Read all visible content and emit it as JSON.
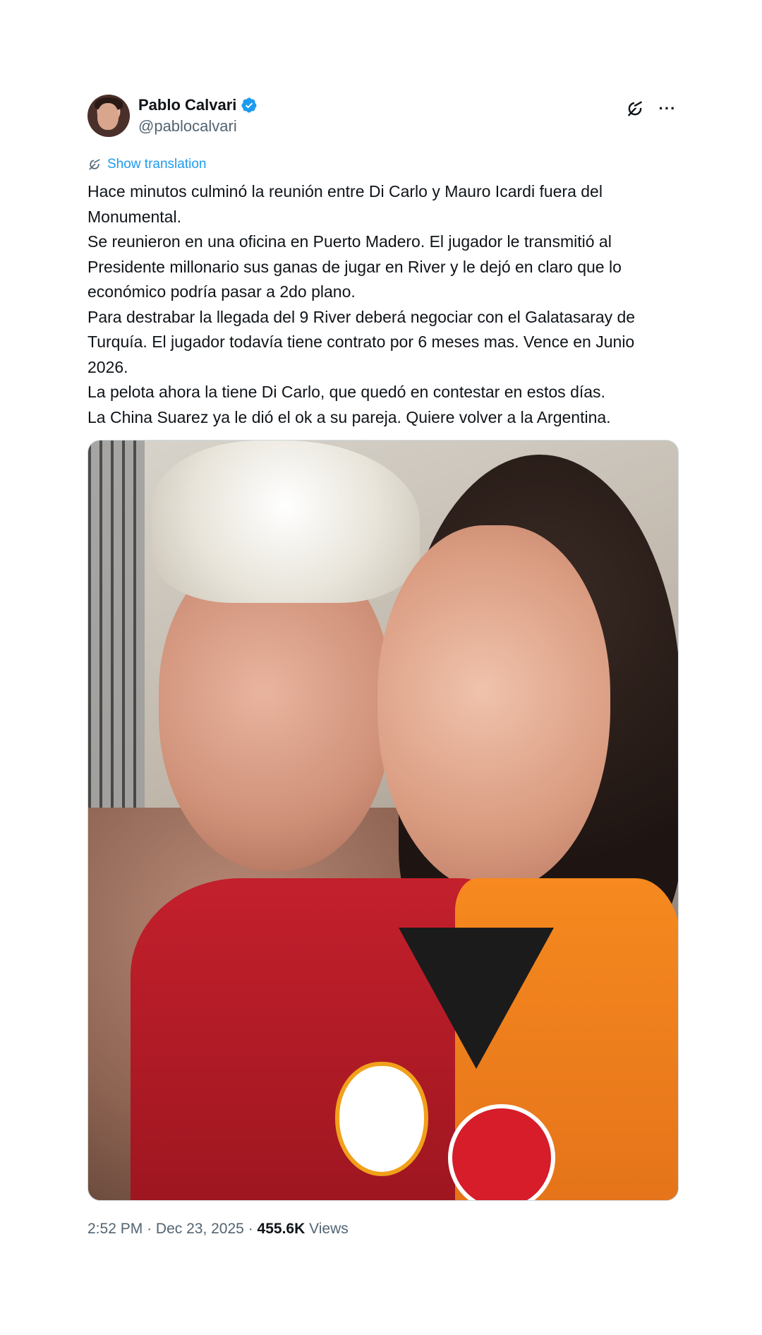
{
  "author": {
    "display_name": "Pablo Calvari",
    "handle": "@pablocalvari",
    "verified_icon": "verified-badge-icon",
    "avatar_icon": "avatar"
  },
  "header_actions": {
    "grok_icon": "grok-icon",
    "more_label": "···"
  },
  "translation": {
    "icon": "grok-icon",
    "label": "Show translation"
  },
  "tweet_text": {
    "lines": [
      "Hace minutos culminó la reunión entre Di Carlo y Mauro Icardi fuera del Monumental.",
      "Se reunieron en una oficina en Puerto Madero. El jugador le transmitió al Presidente millonario sus ganas de jugar en River y le dejó en claro que lo económico podría pasar a 2do plano.",
      "Para destrabar la llegada del 9 River deberá negociar con el Galatasaray de Turquía. El jugador todavía tiene contrato por 6 meses mas. Vence en Junio 2026.",
      "La pelota ahora la tiene Di Carlo, que quedó en contestar en estos días.",
      "La China Suarez ya le dió el ok a su pareja. Quiere volver a la Argentina."
    ]
  },
  "media": {
    "type": "photo"
  },
  "meta": {
    "time": "2:52 PM",
    "separator": "·",
    "date": "Dec 23, 2025",
    "views_count": "455.6K",
    "views_label": "Views"
  },
  "colors": {
    "accent": "#1d9bf0",
    "text": "#0f1419",
    "secondary": "#536471"
  }
}
